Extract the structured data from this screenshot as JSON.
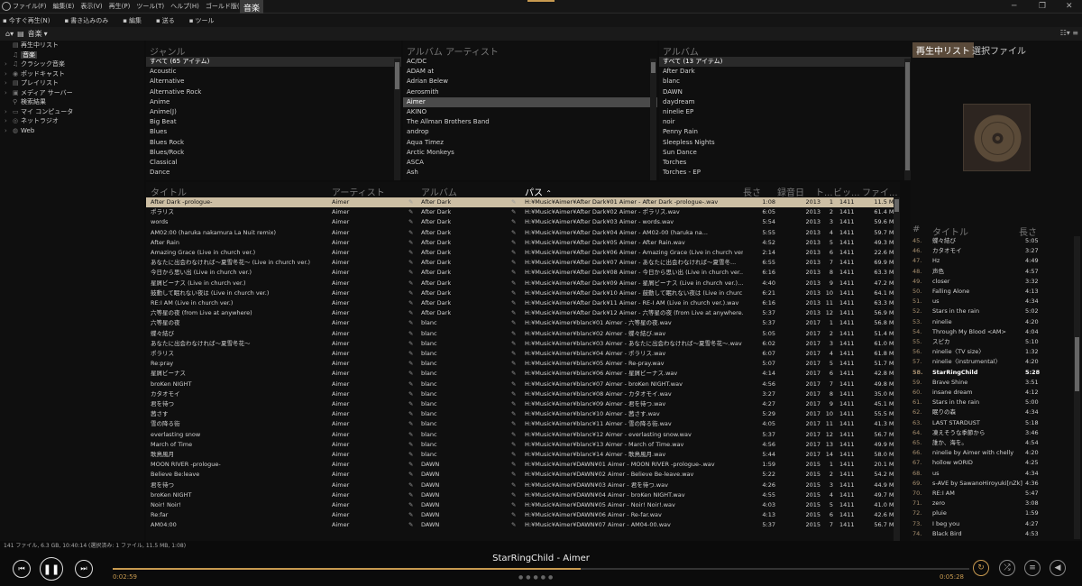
{
  "menu": [
    "ファイル(F)",
    "編集(E)",
    "表示(V)",
    "再生(P)",
    "ツール(T)",
    "ヘルプ(H)",
    "ゴールド版(G)"
  ],
  "active_tab": "音楽",
  "toolbar": [
    "今すぐ再生(N)",
    "書き込みのみ",
    "編集",
    "送る",
    "ツール"
  ],
  "breadcrumb": "音楽",
  "sidebar": [
    {
      "label": "再生中リスト",
      "icon": "playlist-icon"
    },
    {
      "label": "音楽",
      "icon": "music-icon",
      "selected": true
    },
    {
      "label": "クラシック音楽",
      "icon": "music-icon"
    },
    {
      "label": "ポッドキャスト",
      "icon": "podcast-icon"
    },
    {
      "label": "プレイリスト",
      "icon": "playlist-icon"
    },
    {
      "label": "メディア サーバー",
      "icon": "server-icon"
    },
    {
      "label": "検索結果",
      "icon": "search-icon"
    },
    {
      "label": "マイ コンピュータ",
      "icon": "computer-icon"
    },
    {
      "label": "ネットラジオ",
      "icon": "radio-icon"
    },
    {
      "label": "Web",
      "icon": "web-icon"
    }
  ],
  "genre": {
    "header": "ジャンル",
    "items": [
      "すべて (65 アイテム)",
      "Acoustic",
      "Alternative",
      "Alternative Rock",
      "Anime",
      "Anime(J)",
      "Big Beat",
      "Blues",
      "Blues Rock",
      "Blues/Rock",
      "Classical",
      "Dance"
    ]
  },
  "album_artist": {
    "header": "アルバム アーティスト",
    "items": [
      "AC/DC",
      "ADAM at",
      "Adrian Belew",
      "Aerosmith",
      "Aimer",
      "AKINO",
      "The Allman Brothers Band",
      "androp",
      "Aqua Timez",
      "Arctic Monkeys",
      "ASCA",
      "Ash"
    ],
    "selected": 4
  },
  "album": {
    "header": "アルバム",
    "items": [
      "すべて (13 アイテム)",
      "After Dark",
      "blanc",
      "DAWN",
      "daydream",
      "ninelie EP",
      "noir",
      "Penny Rain",
      "Sleepless Nights",
      "Sun Dance",
      "Torches",
      "Torches - EP"
    ]
  },
  "track_headers": {
    "title": "タイトル",
    "artist": "アーティスト",
    "album": "アルバム",
    "path": "パス",
    "length": "長さ",
    "year": "録音日",
    "track": "ト...",
    "bitrate": "ビッ...",
    "size": "ファイ..."
  },
  "tracks": [
    [
      "After Dark -prologue-",
      "Aimer",
      "After Dark",
      "H:¥Music¥Aimer¥After Dark¥01 Aimer - After Dark -prologue-.wav",
      "1:08",
      "2013",
      "1",
      "1411",
      "11.5 MB"
    ],
    [
      "ポラリス",
      "Aimer",
      "After Dark",
      "H:¥Music¥Aimer¥After Dark¥02 Aimer - ポラリス.wav",
      "6:05",
      "2013",
      "2",
      "1411",
      "61.4 MB"
    ],
    [
      "words",
      "Aimer",
      "After Dark",
      "H:¥Music¥Aimer¥After Dark¥03 Aimer - words.wav",
      "5:54",
      "2013",
      "3",
      "1411",
      "59.6 MB"
    ],
    [
      "AM02:00 (haruka nakamura La Nuit remix)",
      "Aimer",
      "After Dark",
      "H:¥Music¥Aimer¥After Dark¥04 Aimer - AM02-00 (haruka na...",
      "5:55",
      "2013",
      "4",
      "1411",
      "59.7 MB"
    ],
    [
      "After Rain",
      "Aimer",
      "After Dark",
      "H:¥Music¥Aimer¥After Dark¥05 Aimer - After Rain.wav",
      "4:52",
      "2013",
      "5",
      "1411",
      "49.3 MB"
    ],
    [
      "Amazing Grace (Live in church ver.)",
      "Aimer",
      "After Dark",
      "H:¥Music¥Aimer¥After Dark¥06 Aimer - Amazing Grace (Live in church ver...",
      "2:14",
      "2013",
      "6",
      "1411",
      "22.6 MB"
    ],
    [
      "あなたに出会わなければ～夏雪冬花～ (Live in church ver.)",
      "Aimer",
      "After Dark",
      "H:¥Music¥Aimer¥After Dark¥07 Aimer - あなたに出会わなければ～夏雪冬...",
      "6:55",
      "2013",
      "7",
      "1411",
      "69.9 MB"
    ],
    [
      "今日から思い出 (Live in church ver.)",
      "Aimer",
      "After Dark",
      "H:¥Music¥Aimer¥After Dark¥08 Aimer - 今日から思い出 (Live in church ver...",
      "6:16",
      "2013",
      "8",
      "1411",
      "63.3 MB"
    ],
    [
      "星屑ビーナス (Live in church ver.)",
      "Aimer",
      "After Dark",
      "H:¥Music¥Aimer¥After Dark¥09 Aimer - 星屑ビーナス (Live in church ver.)...",
      "4:40",
      "2013",
      "9",
      "1411",
      "47.2 MB"
    ],
    [
      "鼓動して眠れない夜は (Live in church ver.)",
      "Aimer",
      "After Dark",
      "H:¥Music¥Aimer¥After Dark¥10 Aimer - 鼓動して眠れない夜は (Live in churc...",
      "6:21",
      "2013",
      "10",
      "1411",
      "64.1 MB"
    ],
    [
      "RE:I AM (Live in church ver.)",
      "Aimer",
      "After Dark",
      "H:¥Music¥Aimer¥After Dark¥11 Aimer - RE-I AM (Live in church ver.).wav",
      "6:16",
      "2013",
      "11",
      "1411",
      "63.3 MB"
    ],
    [
      "六等星の夜 (from Live at anywhere)",
      "Aimer",
      "After Dark",
      "H:¥Music¥Aimer¥After Dark¥12 Aimer - 六等星の夜 (from Live at anywhere...",
      "5:37",
      "2013",
      "12",
      "1411",
      "56.9 MB"
    ],
    [
      "六等星の夜",
      "Aimer",
      "blanc",
      "H:¥Music¥Aimer¥blanc¥01 Aimer - 六等星の夜.wav",
      "5:37",
      "2017",
      "1",
      "1411",
      "56.8 MB"
    ],
    [
      "蝶々結び",
      "Aimer",
      "blanc",
      "H:¥Music¥Aimer¥blanc¥02 Aimer - 蝶々結び.wav",
      "5:05",
      "2017",
      "2",
      "1411",
      "51.4 MB"
    ],
    [
      "あなたに出会わなければ～夏雪冬花～",
      "Aimer",
      "blanc",
      "H:¥Music¥Aimer¥blanc¥03 Aimer - あなたに出会わなければ～夏雪冬花～.wav",
      "6:02",
      "2017",
      "3",
      "1411",
      "61.0 MB"
    ],
    [
      "ポラリス",
      "Aimer",
      "blanc",
      "H:¥Music¥Aimer¥blanc¥04 Aimer - ポラリス.wav",
      "6:07",
      "2017",
      "4",
      "1411",
      "61.8 MB"
    ],
    [
      "Re:pray",
      "Aimer",
      "blanc",
      "H:¥Music¥Aimer¥blanc¥05 Aimer - Re-pray.wav",
      "5:07",
      "2017",
      "5",
      "1411",
      "51.7 MB"
    ],
    [
      "星屑ビーナス",
      "Aimer",
      "blanc",
      "H:¥Music¥Aimer¥blanc¥06 Aimer - 星屑ビーナス.wav",
      "4:14",
      "2017",
      "6",
      "1411",
      "42.8 MB"
    ],
    [
      "broKen NIGHT",
      "Aimer",
      "blanc",
      "H:¥Music¥Aimer¥blanc¥07 Aimer - broKen NIGHT.wav",
      "4:56",
      "2017",
      "7",
      "1411",
      "49.8 MB"
    ],
    [
      "カタオモイ",
      "Aimer",
      "blanc",
      "H:¥Music¥Aimer¥blanc¥08 Aimer - カタオモイ.wav",
      "3:27",
      "2017",
      "8",
      "1411",
      "35.0 MB"
    ],
    [
      "君を待つ",
      "Aimer",
      "blanc",
      "H:¥Music¥Aimer¥blanc¥09 Aimer - 君を待つ.wav",
      "4:27",
      "2017",
      "9",
      "1411",
      "45.1 MB"
    ],
    [
      "茜さす",
      "Aimer",
      "blanc",
      "H:¥Music¥Aimer¥blanc¥10 Aimer - 茜さす.wav",
      "5:29",
      "2017",
      "10",
      "1411",
      "55.5 MB"
    ],
    [
      "雪の降る街",
      "Aimer",
      "blanc",
      "H:¥Music¥Aimer¥blanc¥11 Aimer - 雪の降る街.wav",
      "4:05",
      "2017",
      "11",
      "1411",
      "41.3 MB"
    ],
    [
      "everlasting snow",
      "Aimer",
      "blanc",
      "H:¥Music¥Aimer¥blanc¥12 Aimer - everlasting snow.wav",
      "5:37",
      "2017",
      "12",
      "1411",
      "56.7 MB"
    ],
    [
      "March of Time",
      "Aimer",
      "blanc",
      "H:¥Music¥Aimer¥blanc¥13 Aimer - March of Time.wav",
      "4:56",
      "2017",
      "13",
      "1411",
      "49.9 MB"
    ],
    [
      "歌鳥風月",
      "Aimer",
      "blanc",
      "H:¥Music¥Aimer¥blanc¥14 Aimer - 歌鳥風月.wav",
      "5:44",
      "2017",
      "14",
      "1411",
      "58.0 MB"
    ],
    [
      "MOON RIVER -prologue-",
      "Aimer",
      "DAWN",
      "H:¥Music¥Aimer¥DAWN¥01 Aimer - MOON RIVER -prologue-.wav",
      "1:59",
      "2015",
      "1",
      "1411",
      "20.1 MB"
    ],
    [
      "Believe Be:leave",
      "Aimer",
      "DAWN",
      "H:¥Music¥Aimer¥DAWN¥02 Aimer - Believe Be-leave.wav",
      "5:22",
      "2015",
      "2",
      "1411",
      "54.2 MB"
    ],
    [
      "君を待つ",
      "Aimer",
      "DAWN",
      "H:¥Music¥Aimer¥DAWN¥03 Aimer - 君を待つ.wav",
      "4:26",
      "2015",
      "3",
      "1411",
      "44.9 MB"
    ],
    [
      "broKen NIGHT",
      "Aimer",
      "DAWN",
      "H:¥Music¥Aimer¥DAWN¥04 Aimer - broKen NIGHT.wav",
      "4:55",
      "2015",
      "4",
      "1411",
      "49.7 MB"
    ],
    [
      "Noir! Noir!",
      "Aimer",
      "DAWN",
      "H:¥Music¥Aimer¥DAWN¥05 Aimer - Noir! Noir!.wav",
      "4:03",
      "2015",
      "5",
      "1411",
      "41.0 MB"
    ],
    [
      "Re:far",
      "Aimer",
      "DAWN",
      "H:¥Music¥Aimer¥DAWN¥06 Aimer - Re-far.wav",
      "4:13",
      "2015",
      "6",
      "1411",
      "42.6 MB"
    ],
    [
      "AM04:00",
      "Aimer",
      "DAWN",
      "H:¥Music¥Aimer¥DAWN¥07 Aimer - AM04-00.wav",
      "5:37",
      "2015",
      "7",
      "1411",
      "56.7 MB"
    ]
  ],
  "right_tabs": [
    "再生中リスト",
    "選択ファイル"
  ],
  "playlist_headers": {
    "num": "#",
    "title": "タイトル",
    "length": "長さ"
  },
  "playlist": [
    [
      "45.",
      "蝶々結び",
      "5:05"
    ],
    [
      "46.",
      "カタオモイ",
      "3:27"
    ],
    [
      "47.",
      "Hz",
      "4:49"
    ],
    [
      "48.",
      "声色",
      "4:57"
    ],
    [
      "49.",
      "closer",
      "3:32"
    ],
    [
      "50.",
      "Falling Alone",
      "4:13"
    ],
    [
      "51.",
      "us",
      "4:34"
    ],
    [
      "52.",
      "Stars in the rain",
      "5:02"
    ],
    [
      "53.",
      "ninelie",
      "4:20"
    ],
    [
      "54.",
      "Through My Blood <AM>",
      "4:04"
    ],
    [
      "55.",
      "スピカ",
      "5:10"
    ],
    [
      "56.",
      "ninelie〈TV size〉",
      "1:32"
    ],
    [
      "57.",
      "ninelie〈instrumental〉",
      "4:20"
    ],
    [
      "58.",
      "StarRingChild",
      "5:28"
    ],
    [
      "59.",
      "Brave Shine",
      "3:51"
    ],
    [
      "60.",
      "insane dream",
      "4:12"
    ],
    [
      "61.",
      "Stars in the rain",
      "5:00"
    ],
    [
      "62.",
      "眠りの森",
      "4:34"
    ],
    [
      "63.",
      "LAST STARDUST",
      "5:18"
    ],
    [
      "64.",
      "凍えそうな季節から",
      "3:46"
    ],
    [
      "65.",
      "誰か、海を。",
      "4:54"
    ],
    [
      "66.",
      "ninelie by Aimer with chelly",
      "4:20"
    ],
    [
      "67.",
      "hollow wORID",
      "4:25"
    ],
    [
      "68.",
      "us",
      "4:34"
    ],
    [
      "69.",
      "s-AVE by SawanoHiroyuki[nZk]",
      "4:36"
    ],
    [
      "70.",
      "RE:I AM",
      "5:47"
    ],
    [
      "71.",
      "zero",
      "3:08"
    ],
    [
      "72.",
      "pluie",
      "1:59"
    ],
    [
      "73.",
      "I beg you",
      "4:27"
    ],
    [
      "74.",
      "Black Bird",
      "4:53"
    ]
  ],
  "current_index": 13,
  "status": "141 ファイル, 6.3 GB, 10:40:14 (選択済み: 1 ファイル, 11.5 MB, 1:08)",
  "player": {
    "now_playing": "StarRingChild - Aimer",
    "elapsed": "0:02:59",
    "remaining": "0:05:28",
    "progress": 0.546
  },
  "accent_color": "#c89a50"
}
